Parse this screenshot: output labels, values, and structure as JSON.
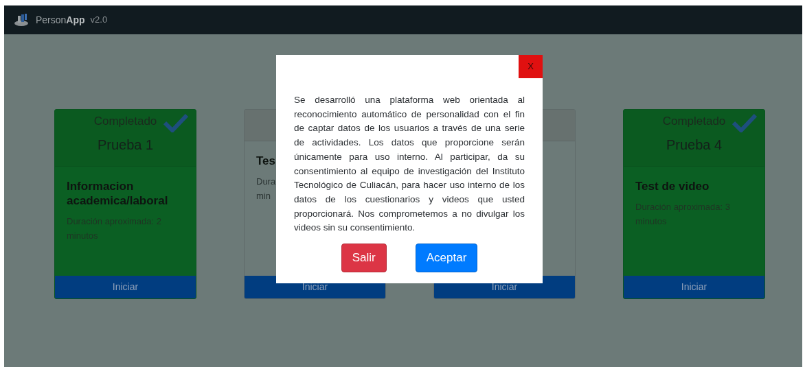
{
  "navbar": {
    "brand_light": "Person",
    "brand_bold": "App",
    "version": "v2.0"
  },
  "cards": [
    {
      "completed": true,
      "status": "Completado",
      "title": "Prueba 1",
      "name": "Informacion academica/laboral",
      "description_lines": [
        "Duración aproximada: 2",
        "minutos"
      ],
      "button": "Iniciar"
    },
    {
      "completed": false,
      "name": "Tes",
      "description_lines": [
        "Dura",
        "min"
      ],
      "button": "Iniciar"
    },
    {
      "completed": false,
      "button": "Iniciar"
    },
    {
      "completed": true,
      "status": "Completado",
      "title": "Prueba 4",
      "name": "Test de video",
      "description_lines": [
        "Duración aproximada: 3",
        "minutos"
      ],
      "button": "Iniciar"
    }
  ],
  "modal": {
    "close": "X",
    "text": "Se desarrolló una plataforma web orientada al reconocimiento automático de personalidad con el fin de captar datos de los usuarios a través de una serie de actividades. Los datos que proporcione serán únicamente para uso interno. Al participar, da su consentimiento al equipo de investigación del Instituto Tecnológico de Culiacán, para hacer uso interno de los datos de los cuestionarios y videos que usted proporcionará. Nos comprometemos a no divulgar los videos sin su consentimiento.",
    "buttons": [
      {
        "label": "Salir",
        "kind": "danger"
      },
      {
        "label": "Aceptar",
        "kind": "primary"
      }
    ]
  }
}
